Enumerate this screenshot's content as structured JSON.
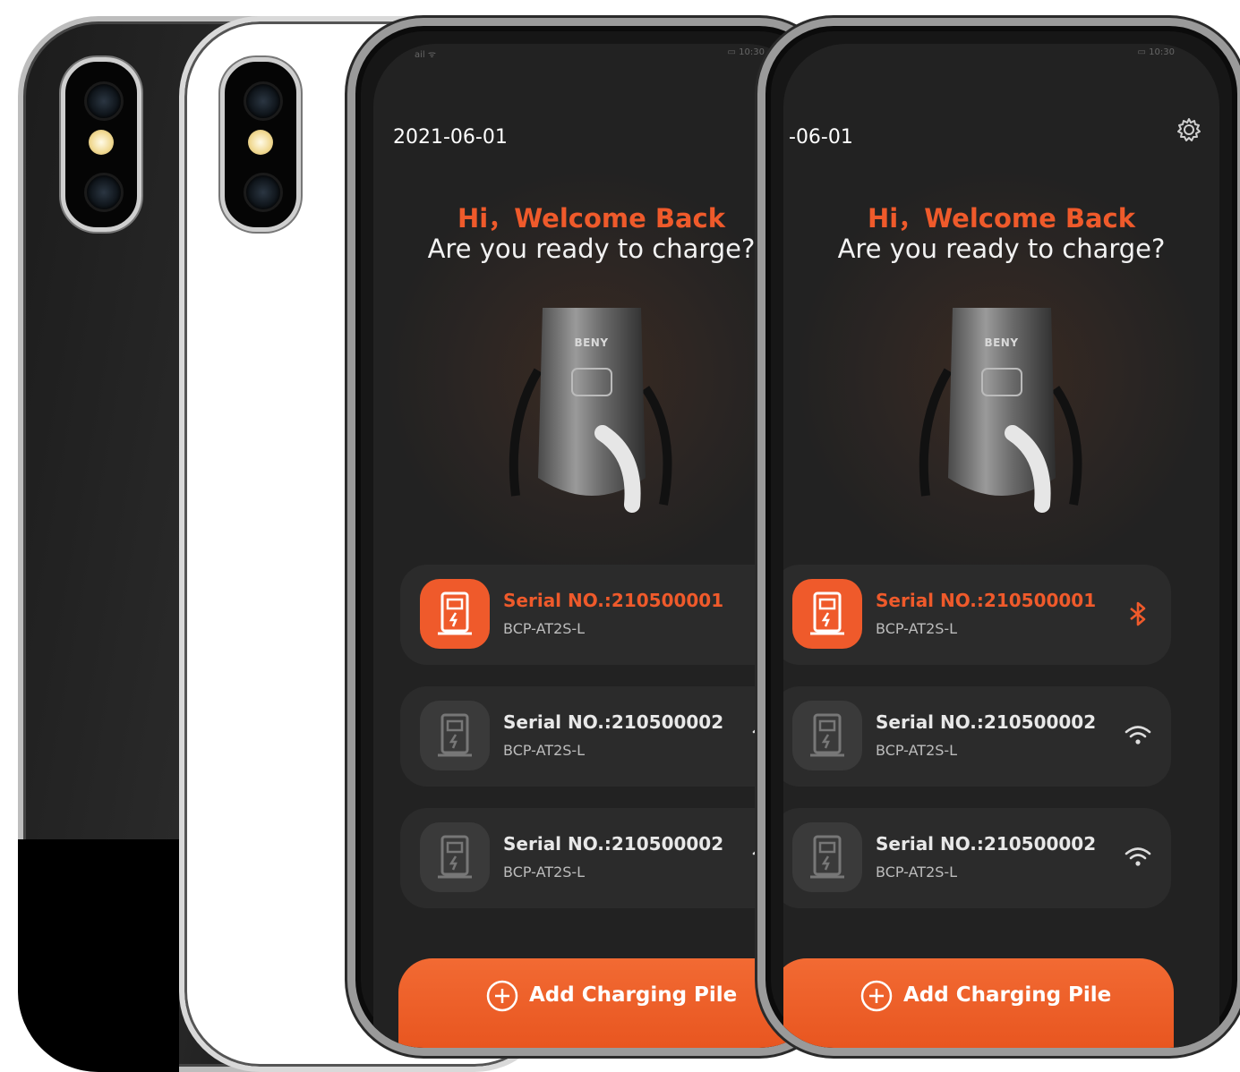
{
  "phones": [
    {
      "status_left": "ail ᯤ",
      "status_right": "▭ 10:30",
      "date": "2021-06-01",
      "greeting": "Hi，Welcome Back",
      "subtitle": "Are you ready to charge?",
      "charger_brand": "BENY",
      "devices": [
        {
          "serial": "Serial NO.:210500001",
          "model": "BCP-AT2S-L",
          "connection": "bluetooth"
        },
        {
          "serial": "Serial NO.:210500002",
          "model": "BCP-AT2S-L",
          "connection": "wifi"
        },
        {
          "serial": "Serial NO.:210500002",
          "model": "BCP-AT2S-L",
          "connection": "wifi"
        }
      ],
      "add_button": "Add Charging Pile"
    },
    {
      "status_left": "ail ᯤ",
      "status_right": "▭ 10:30",
      "date": "-06-01",
      "greeting": "Hi，Welcome Back",
      "subtitle": "Are you ready to charge?",
      "charger_brand": "BENY",
      "devices": [
        {
          "serial": "Serial NO.:210500001",
          "model": "BCP-AT2S-L",
          "connection": "bluetooth"
        },
        {
          "serial": "Serial NO.:210500002",
          "model": "BCP-AT2S-L",
          "connection": "wifi"
        },
        {
          "serial": "Serial NO.:210500002",
          "model": "BCP-AT2S-L",
          "connection": "wifi"
        }
      ],
      "add_button": "Add Charging Pile"
    }
  ],
  "colors": {
    "accent": "#ef5a2b",
    "background": "#222222",
    "card": "#2b2b2b"
  }
}
